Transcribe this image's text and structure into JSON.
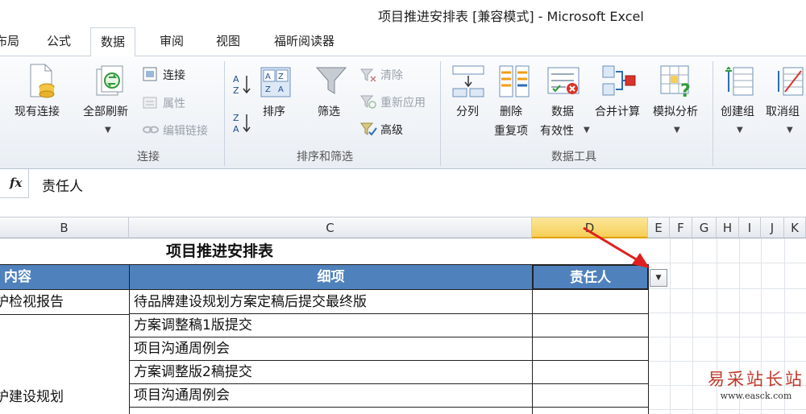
{
  "window": {
    "title": "项目推进安排表  [兼容模式]  -  Microsoft Excel"
  },
  "tabs": [
    {
      "label": "布局",
      "active": false
    },
    {
      "label": "公式",
      "active": false
    },
    {
      "label": "数据",
      "active": true
    },
    {
      "label": "审阅",
      "active": false
    },
    {
      "label": "视图",
      "active": false
    },
    {
      "label": "福昕阅读器",
      "active": false
    }
  ],
  "ribbon": {
    "connections_group": {
      "label": "连接",
      "existing_connections": "现有连接",
      "refresh_all": "全部刷新",
      "connections": "连接",
      "properties": "属性",
      "edit_links": "编辑链接"
    },
    "sort_filter_group": {
      "label": "排序和筛选",
      "sort": "排序",
      "filter": "筛选",
      "clear": "清除",
      "reapply": "重新应用",
      "advanced": "高级"
    },
    "data_tools_group": {
      "label": "数据工具",
      "text_to_columns": "分列",
      "remove_duplicates_line1": "删除",
      "remove_duplicates_line2": "重复项",
      "data_validation_line1": "数据",
      "data_validation_line2": "有效性",
      "consolidate": "合并计算",
      "what_if": "模拟分析"
    },
    "outline_group": {
      "group": "创建组",
      "ungroup": "取消组"
    }
  },
  "formula_bar": {
    "fx": "fx",
    "value": "责任人"
  },
  "sheet": {
    "columns": [
      "B",
      "C",
      "D",
      "E",
      "F",
      "G",
      "H",
      "I",
      "J",
      "K"
    ],
    "selected_column": "D",
    "title": "项目推进安排表",
    "header": {
      "content": "内容",
      "detail": "细项",
      "owner": "责任人"
    },
    "rows": [
      {
        "content": "护检视报告",
        "detail": "待品牌建设规划方案定稿后提交最终版"
      },
      {
        "content": "",
        "detail": "方案调整稿1版提交"
      },
      {
        "content": "",
        "detail": "项目沟通周例会"
      },
      {
        "content": "",
        "detail": "方案调整版2稿提交"
      },
      {
        "content": "护建设规划",
        "detail": "项目沟通周例会"
      }
    ],
    "filter_button": "▼"
  },
  "watermark": {
    "line1": "易采站长站",
    "line2": "www.easck.com"
  },
  "colors": {
    "header_fill": "#4f81bd",
    "selected_column": "#f5cf58",
    "arrow": "#e02020"
  }
}
